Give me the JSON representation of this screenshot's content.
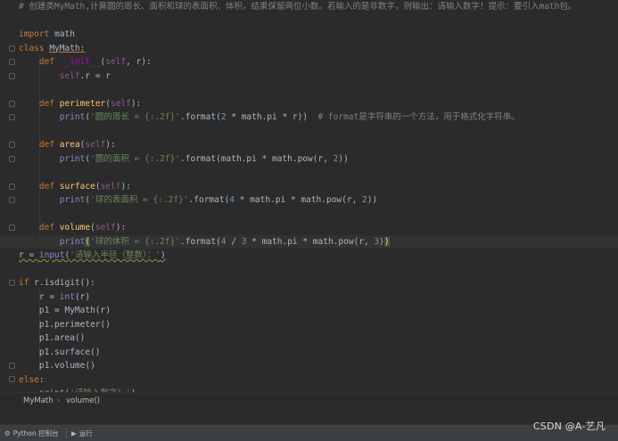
{
  "editor": {
    "lines": [
      [
        {
          "c": "cmt",
          "t": "# 创建类MyMath,计算圆的周长、面积和球的表面积、体积，结果保留两位小数。若输入的是非数字，则输出：请输入数字！提示：要引入math包。"
        }
      ],
      [],
      [
        {
          "c": "kw",
          "t": "import "
        },
        {
          "c": "plain",
          "t": "math"
        }
      ],
      [
        {
          "c": "kw",
          "t": "class "
        },
        {
          "c": "plain",
          "t": "MyMath:"
        }
      ],
      [
        {
          "c": "plain",
          "t": "    "
        },
        {
          "c": "kw",
          "t": "def "
        },
        {
          "c": "magic",
          "t": "__init__"
        },
        {
          "c": "plain",
          "t": "("
        },
        {
          "c": "self",
          "t": "self"
        },
        {
          "c": "plain",
          "t": ", r):"
        }
      ],
      [
        {
          "c": "plain",
          "t": "        "
        },
        {
          "c": "self",
          "t": "self"
        },
        {
          "c": "plain",
          "t": ".r = r"
        }
      ],
      [],
      [
        {
          "c": "plain",
          "t": "    "
        },
        {
          "c": "kw",
          "t": "def "
        },
        {
          "c": "fn",
          "t": "perimeter"
        },
        {
          "c": "plain",
          "t": "("
        },
        {
          "c": "self",
          "t": "self"
        },
        {
          "c": "plain",
          "t": "):"
        }
      ],
      [
        {
          "c": "plain",
          "t": "        "
        },
        {
          "c": "bi",
          "t": "print"
        },
        {
          "c": "plain",
          "t": "("
        },
        {
          "c": "str",
          "t": "'圆的周长 = {:.2f}'"
        },
        {
          "c": "plain",
          "t": ".format("
        },
        {
          "c": "num",
          "t": "2"
        },
        {
          "c": "plain",
          "t": " * math.pi * r))  "
        },
        {
          "c": "cmt",
          "t": "# format是字符串的一个方法，用于格式化字符串。"
        }
      ],
      [],
      [
        {
          "c": "plain",
          "t": "    "
        },
        {
          "c": "kw",
          "t": "def "
        },
        {
          "c": "fn",
          "t": "area"
        },
        {
          "c": "plain",
          "t": "("
        },
        {
          "c": "self",
          "t": "self"
        },
        {
          "c": "plain",
          "t": "):"
        }
      ],
      [
        {
          "c": "plain",
          "t": "        "
        },
        {
          "c": "bi",
          "t": "print"
        },
        {
          "c": "plain",
          "t": "("
        },
        {
          "c": "str",
          "t": "'圆的面积 = {:.2f}'"
        },
        {
          "c": "plain",
          "t": ".format(math.pi * math.pow(r, "
        },
        {
          "c": "num",
          "t": "2"
        },
        {
          "c": "plain",
          "t": "))"
        }
      ],
      [],
      [
        {
          "c": "plain",
          "t": "    "
        },
        {
          "c": "kw",
          "t": "def "
        },
        {
          "c": "fn",
          "t": "surface"
        },
        {
          "c": "plain",
          "t": "("
        },
        {
          "c": "self",
          "t": "self"
        },
        {
          "c": "plain",
          "t": "):"
        }
      ],
      [
        {
          "c": "plain",
          "t": "        "
        },
        {
          "c": "bi",
          "t": "print"
        },
        {
          "c": "plain",
          "t": "("
        },
        {
          "c": "str",
          "t": "'球的表面积 = {:.2f}'"
        },
        {
          "c": "plain",
          "t": ".format("
        },
        {
          "c": "num",
          "t": "4"
        },
        {
          "c": "plain",
          "t": " * math.pi * math.pow(r, "
        },
        {
          "c": "num",
          "t": "2"
        },
        {
          "c": "plain",
          "t": "))"
        }
      ],
      [],
      [
        {
          "c": "plain",
          "t": "    "
        },
        {
          "c": "kw",
          "t": "def "
        },
        {
          "c": "fn",
          "t": "volume"
        },
        {
          "c": "plain",
          "t": "("
        },
        {
          "c": "self",
          "t": "self"
        },
        {
          "c": "plain",
          "t": "):"
        }
      ],
      [
        {
          "c": "plain",
          "t": "        "
        },
        {
          "c": "bi",
          "t": "print"
        },
        {
          "c": "brk",
          "t": "("
        },
        {
          "c": "str",
          "t": "'球的体积 = {:.2f}'"
        },
        {
          "c": "plain",
          "t": ".format("
        },
        {
          "c": "num",
          "t": "4"
        },
        {
          "c": "plain",
          "t": " / "
        },
        {
          "c": "num",
          "t": "3"
        },
        {
          "c": "plain",
          "t": " * math.pi * math.pow(r, "
        },
        {
          "c": "num",
          "t": "3"
        },
        {
          "c": "plain",
          "t": ")"
        },
        {
          "c": "brk",
          "t": ")"
        }
      ],
      [
        {
          "c": "plain",
          "t": "r = "
        },
        {
          "c": "bi",
          "t": "input"
        },
        {
          "c": "plain",
          "t": "("
        },
        {
          "c": "str",
          "t": "'请输入半径（整数）：'"
        },
        {
          "c": "plain",
          "t": ")"
        }
      ],
      [],
      [
        {
          "c": "kw",
          "t": "if "
        },
        {
          "c": "plain",
          "t": "r.isdigit():"
        }
      ],
      [
        {
          "c": "plain",
          "t": "    r = "
        },
        {
          "c": "bi",
          "t": "int"
        },
        {
          "c": "plain",
          "t": "(r)"
        }
      ],
      [
        {
          "c": "plain",
          "t": "    p1 = MyMath(r)"
        }
      ],
      [
        {
          "c": "plain",
          "t": "    p1.perimeter()"
        }
      ],
      [
        {
          "c": "plain",
          "t": "    p1.area()"
        }
      ],
      [
        {
          "c": "plain",
          "t": "    p1.surface()"
        }
      ],
      [
        {
          "c": "plain",
          "t": "    p1.volume()"
        }
      ],
      [
        {
          "c": "kw",
          "t": "else"
        },
        {
          "c": "plain",
          "t": ":"
        }
      ],
      [
        {
          "c": "plain",
          "t": "    "
        },
        {
          "c": "bi",
          "t": "print"
        },
        {
          "c": "plain",
          "t": "("
        },
        {
          "c": "str",
          "t": "'请输入数字！'"
        },
        {
          "c": "plain",
          "t": ")"
        }
      ]
    ]
  },
  "breadcrumb": {
    "class_name": "MyMath",
    "separator": "›",
    "method_name": "volume()"
  },
  "bottom_tabs": {
    "console_label": "Python 控制台",
    "run_label": "运行"
  },
  "watermark": "CSDN @A-艺凡",
  "colors": {
    "background": "#2b2b2b",
    "keyword": "#cc7832",
    "function": "#ffc66d",
    "string": "#6a8759",
    "number": "#6897bb",
    "comment": "#808080",
    "self": "#94558d"
  }
}
